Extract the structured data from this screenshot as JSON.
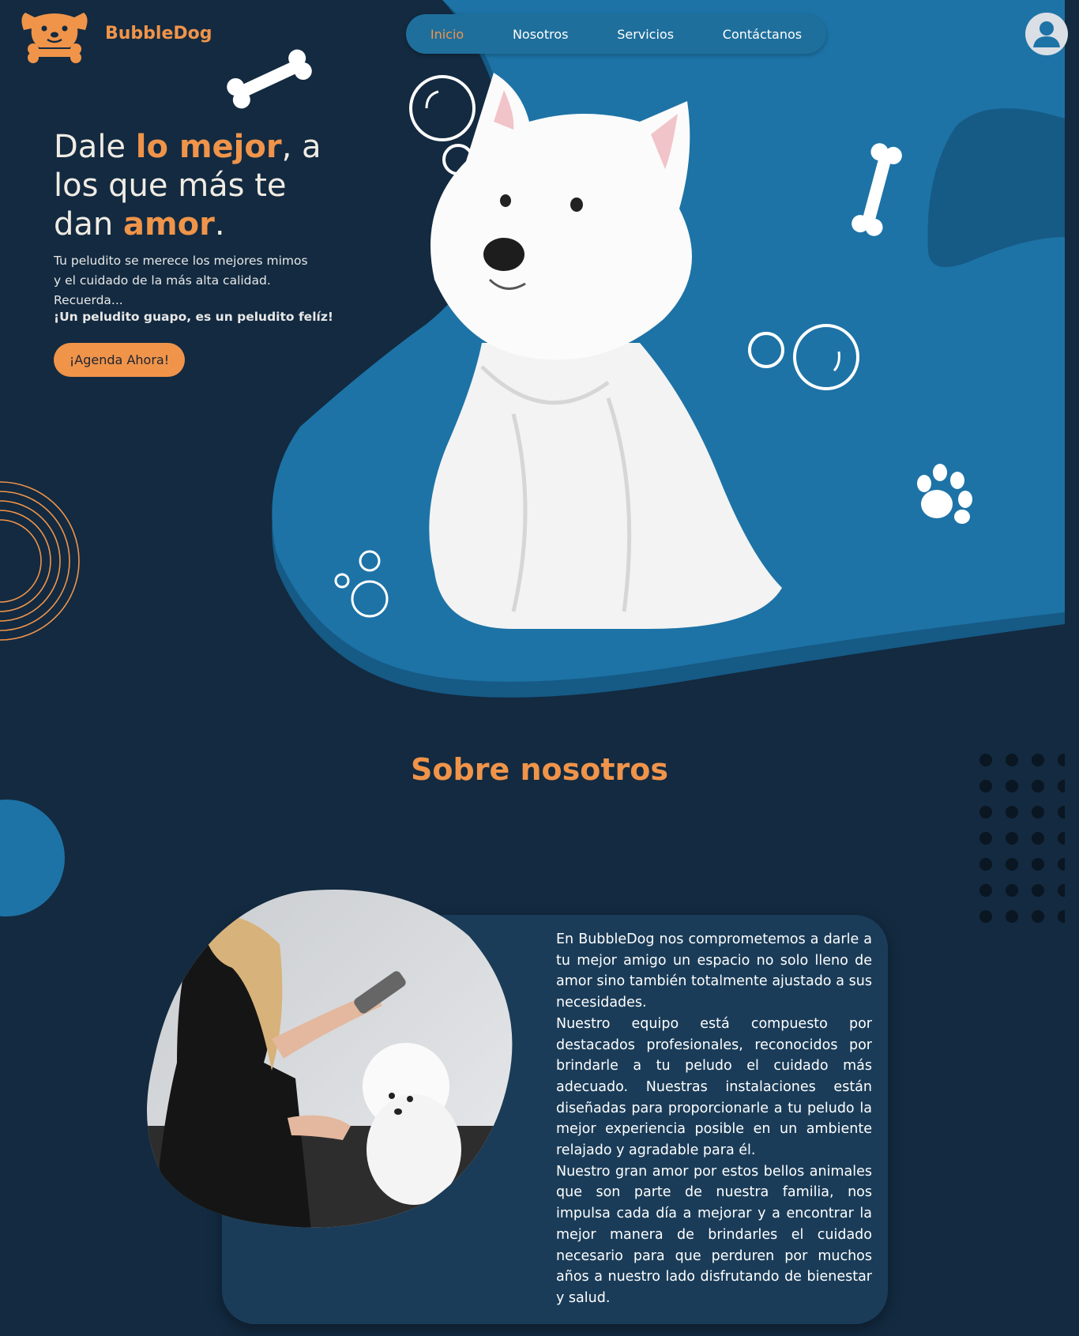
{
  "header": {
    "brand": "BubbleDog",
    "nav": [
      "Inicio",
      "Nosotros",
      "Servicios",
      "Contáctanos"
    ],
    "active_nav": "Inicio"
  },
  "hero": {
    "title_parts": [
      "Dale ",
      "lo mejor",
      ", a los que más te dan ",
      "amor",
      "."
    ],
    "subtitle_lines": [
      "Tu peludito se merece los mejores mimos",
      "y el cuidado de la más alta calidad.",
      "Recuerda..."
    ],
    "tagline": "¡Un peludito guapo, es un peludito felíz!",
    "cta": "¡Agenda Ahora!"
  },
  "about": {
    "title": "Sobre nosotros",
    "paragraphs": [
      "En BubbleDog nos comprometemos a darle a tu mejor amigo un espacio no solo lleno de amor sino también totalmente ajustado a sus necesidades.",
      "Nuestro equipo está compuesto por destacados profesionales, reconocidos por brindarle a tu peludo el cuidado más adecuado. Nuestras instalaciones están diseñadas para proporcionarle a tu peludo la mejor experiencia posible en un ambiente relajado y agradable para él.",
      "Nuestro gran amor por estos bellos animales que son parte de nuestra familia, nos impulsa cada día a mejorar y a encontrar la mejor manera de brindarles el cuidado necesario para que perduren por muchos años a nuestro lado disfrutando de bienestar y salud."
    ]
  },
  "colors": {
    "background": "#132a40",
    "accent": "#f0944a",
    "blob": "#1d73a6",
    "blob_dark": "#165f8c",
    "card": "#1a3c58"
  },
  "icons": [
    "dog-logo-icon",
    "user-avatar-icon",
    "bone-icon",
    "paw-icon",
    "bubble-icon"
  ]
}
